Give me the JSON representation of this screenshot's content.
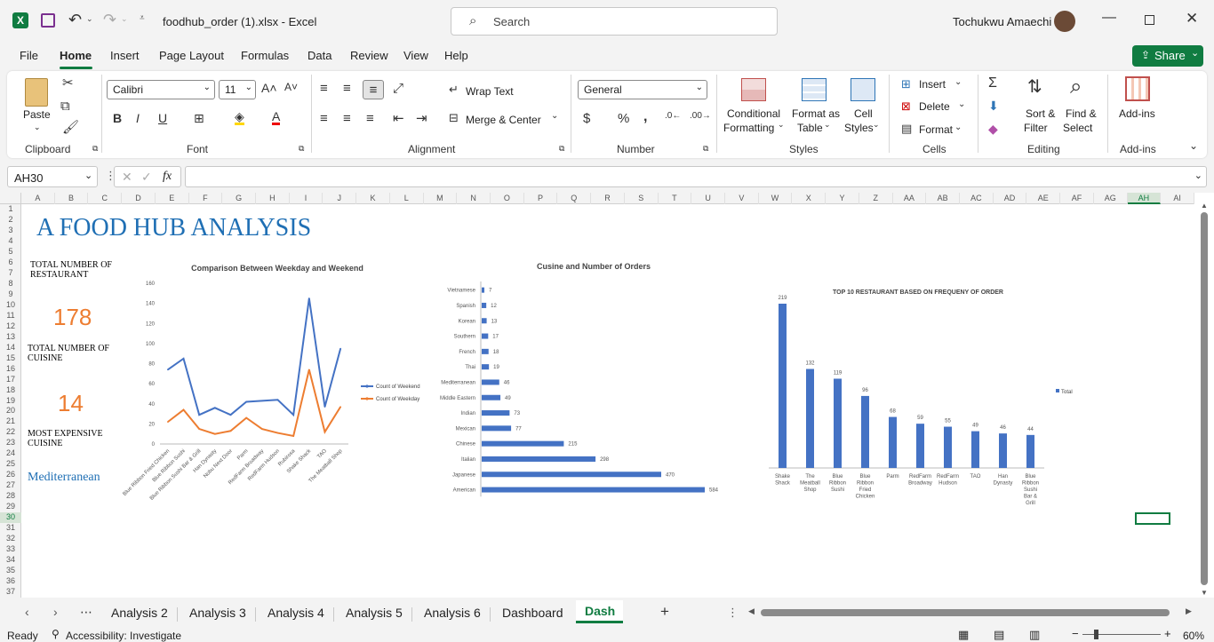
{
  "window": {
    "file_title": "foodhub_order (1).xlsx  -  Excel",
    "search_placeholder": "Search",
    "user_name": "Tochukwu Amaechi",
    "share_label": "Share"
  },
  "menu": [
    "File",
    "Home",
    "Insert",
    "Page Layout",
    "Formulas",
    "Data",
    "Review",
    "View",
    "Help"
  ],
  "ribbon": {
    "clipboard": {
      "paste": "Paste",
      "label": "Clipboard"
    },
    "font": {
      "name": "Calibri",
      "size": "11",
      "label": "Font"
    },
    "alignment": {
      "wrap": "Wrap Text",
      "merge": "Merge & Center",
      "label": "Alignment"
    },
    "number": {
      "format": "General",
      "label": "Number"
    },
    "styles": {
      "cond1": "Conditional",
      "cond2": "Formatting",
      "fmt1": "Format as",
      "fmt2": "Table",
      "cell1": "Cell",
      "cell2": "Styles",
      "label": "Styles"
    },
    "cells": {
      "insert": "Insert",
      "delete": "Delete",
      "format": "Format",
      "label": "Cells"
    },
    "editing": {
      "sort1": "Sort &",
      "sort2": "Filter",
      "find1": "Find &",
      "find2": "Select",
      "label": "Editing"
    },
    "addins": {
      "btn": "Add-ins",
      "label": "Add-ins"
    }
  },
  "formula_bar": {
    "name_box": "AH30",
    "fx": "fx",
    "value": ""
  },
  "columns": [
    "A",
    "B",
    "C",
    "D",
    "E",
    "F",
    "G",
    "H",
    "I",
    "J",
    "K",
    "L",
    "M",
    "N",
    "O",
    "P",
    "Q",
    "R",
    "S",
    "T",
    "U",
    "V",
    "W",
    "X",
    "Y",
    "Z",
    "AA",
    "AB",
    "AC",
    "AD",
    "AE",
    "AF",
    "AG",
    "AH",
    "AI"
  ],
  "rows": [
    "1",
    "2",
    "3",
    "4",
    "5",
    "6",
    "7",
    "8",
    "9",
    "10",
    "11",
    "12",
    "13",
    "14",
    "15",
    "16",
    "17",
    "18",
    "19",
    "20",
    "21",
    "22",
    "23",
    "24",
    "25",
    "26",
    "27",
    "28",
    "29",
    "30",
    "31",
    "32",
    "33",
    "34",
    "35",
    "36",
    "37"
  ],
  "dashboard": {
    "title": "A FOOD HUB ANALYSIS",
    "kpi1_label1": "TOTAL NUMBER OF",
    "kpi1_label2": "RESTAURANT",
    "kpi1_value": "178",
    "kpi2_label1": "TOTAL NUMBER OF",
    "kpi2_label2": "CUISINE",
    "kpi2_value": "14",
    "kpi3_label1": "MOST EXPENSIVE",
    "kpi3_label2": "CUISINE",
    "kpi3_value": "Mediterranean",
    "title_color": "#1f6fb4",
    "kpi_color": "#ed7d31"
  },
  "chart_data": [
    {
      "type": "line",
      "title": "Comparison Between Weekday and Weekend",
      "categories": [
        "Blue Ribbon Fried Chicken",
        "Blue Ribbon Sushi",
        "Blue Ribbon Sushi Bar & Grill",
        "Han Dynasty",
        "Nobu Next Door",
        "Parm",
        "RedFarm Broadway",
        "RedFarm Hudson",
        "Rubirosa",
        "Shake Shack",
        "TAO",
        "The Meatball Shop"
      ],
      "series": [
        {
          "name": "Count of Weekend",
          "color": "#4472c4",
          "values": [
            74,
            85,
            29,
            36,
            29,
            42,
            43,
            44,
            29,
            145,
            37,
            95
          ]
        },
        {
          "name": "Count of Weekday",
          "color": "#ed7d31",
          "values": [
            22,
            34,
            15,
            10,
            13,
            26,
            15,
            11,
            8,
            74,
            12,
            37
          ]
        }
      ],
      "ylim": [
        0,
        160
      ],
      "yticks": [
        "0",
        "20",
        "40",
        "60",
        "80",
        "100",
        "120",
        "140",
        "160"
      ],
      "legend": "right"
    },
    {
      "type": "bar",
      "orientation": "horizontal",
      "title": "Cusine and Number of Orders",
      "categories": [
        "Vietnamese",
        "Spanish",
        "Korean",
        "Southern",
        "French",
        "Thai",
        "Mediterranean",
        "Middle Eastern",
        "Indian",
        "Mexican",
        "Chinese",
        "Italian",
        "Japanese",
        "American"
      ],
      "values": [
        7,
        12,
        13,
        17,
        18,
        19,
        46,
        49,
        73,
        77,
        215,
        298,
        470,
        584
      ],
      "color": "#4472c4"
    },
    {
      "type": "bar",
      "title": "TOP 10 RESTAURANT BASED ON FREQUENY OF ORDER",
      "categories": [
        "Shake Shack",
        "The Meatball Shop",
        "Blue Ribbon Sushi",
        "Blue Ribbon Fried Chicken",
        "Parm",
        "RedFarm Broadway",
        "RedFarm Hudson",
        "TAO",
        "Han Dynasty",
        "Blue Ribbon Sushi Bar & Grill"
      ],
      "values": [
        219,
        132,
        119,
        96,
        68,
        59,
        55,
        49,
        46,
        44
      ],
      "series_name": "Total",
      "color": "#4472c4",
      "legend": "right"
    }
  ],
  "sheet_tabs": [
    "Analysis 2",
    "Analysis 3",
    "Analysis 4",
    "Analysis 5",
    "Analysis 6",
    "Dashboard",
    "Dash"
  ],
  "active_tab": "Dash",
  "status": {
    "ready": "Ready",
    "accessibility": "Accessibility: Investigate",
    "zoom": "60%"
  }
}
